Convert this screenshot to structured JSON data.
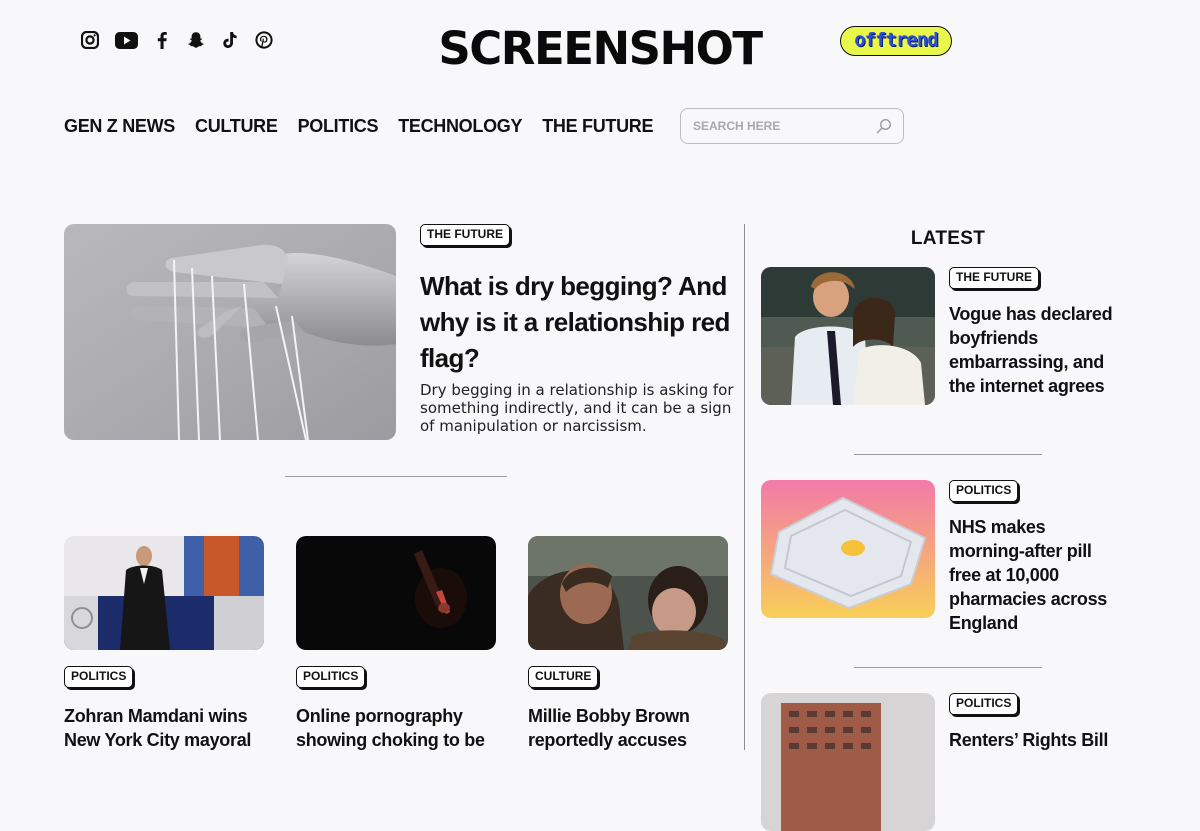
{
  "header": {
    "logo": "SCREENSHOT",
    "offtrend_label": "offtrend",
    "social_icons": [
      "instagram-icon",
      "youtube-icon",
      "facebook-icon",
      "snapchat-icon",
      "tiktok-icon",
      "pinterest-icon"
    ]
  },
  "nav": {
    "items": [
      {
        "label": "GEN Z NEWS"
      },
      {
        "label": "CULTURE"
      },
      {
        "label": "POLITICS"
      },
      {
        "label": "TECHNOLOGY"
      },
      {
        "label": "THE FUTURE"
      }
    ]
  },
  "search": {
    "placeholder": "SEARCH HERE",
    "value": ""
  },
  "featured": {
    "tag": "THE FUTURE",
    "title": "What is dry begging? And why is it a relationship red flag?",
    "description": "Dry begging in a relationship is asking for something indirectly, and it can be a sign of manipulation or narcissism."
  },
  "grid": [
    {
      "tag": "POLITICS",
      "title": "Zohran Mamdani wins New York City mayoral"
    },
    {
      "tag": "POLITICS",
      "title": "Online pornography showing choking to be"
    },
    {
      "tag": "CULTURE",
      "title": "Millie Bobby Brown reportedly accuses"
    }
  ],
  "latest": {
    "heading": "LATEST",
    "items": [
      {
        "tag": "THE FUTURE",
        "title": "Vogue has declared boyfriends embarrassing, and the internet agrees"
      },
      {
        "tag": "POLITICS",
        "title": "NHS makes morning-after pill free at 10,000 pharmacies across England"
      },
      {
        "tag": "POLITICS",
        "title": "Renters’ Rights Bill"
      }
    ]
  },
  "colors": {
    "background": "#f8f8fa",
    "offtrend_fill": "#e9f74a",
    "offtrend_text": "#2a4fd8",
    "text": "#111111"
  }
}
